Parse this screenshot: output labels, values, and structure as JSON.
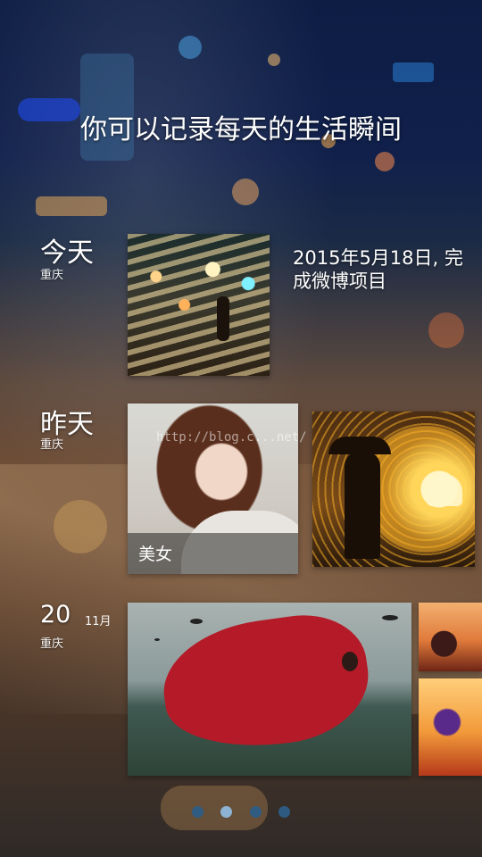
{
  "header": {
    "title": "你可以记录每天的生活瞬间"
  },
  "timeline": [
    {
      "day_label": "今天",
      "location": "重庆",
      "entry_text": "2015年5月18日, 完成微博项目",
      "photos": [
        {
          "name": "night-street-photo"
        }
      ]
    },
    {
      "day_label": "昨天",
      "location": "重庆",
      "photos": [
        {
          "name": "girl-photo",
          "caption": "美女",
          "watermark": "http://blog.c...net/"
        },
        {
          "name": "couple-photo"
        }
      ]
    },
    {
      "day_label": "20",
      "month_label": "11月",
      "location": "重庆",
      "photos": [
        {
          "name": "red-dress-photo"
        },
        {
          "name": "small-photo-1"
        },
        {
          "name": "small-photo-2"
        }
      ]
    }
  ],
  "pager": {
    "count": 4,
    "active_index": 1
  },
  "colors": {
    "dot_inactive": "#2d5d86",
    "dot_active": "#8fb7da"
  }
}
